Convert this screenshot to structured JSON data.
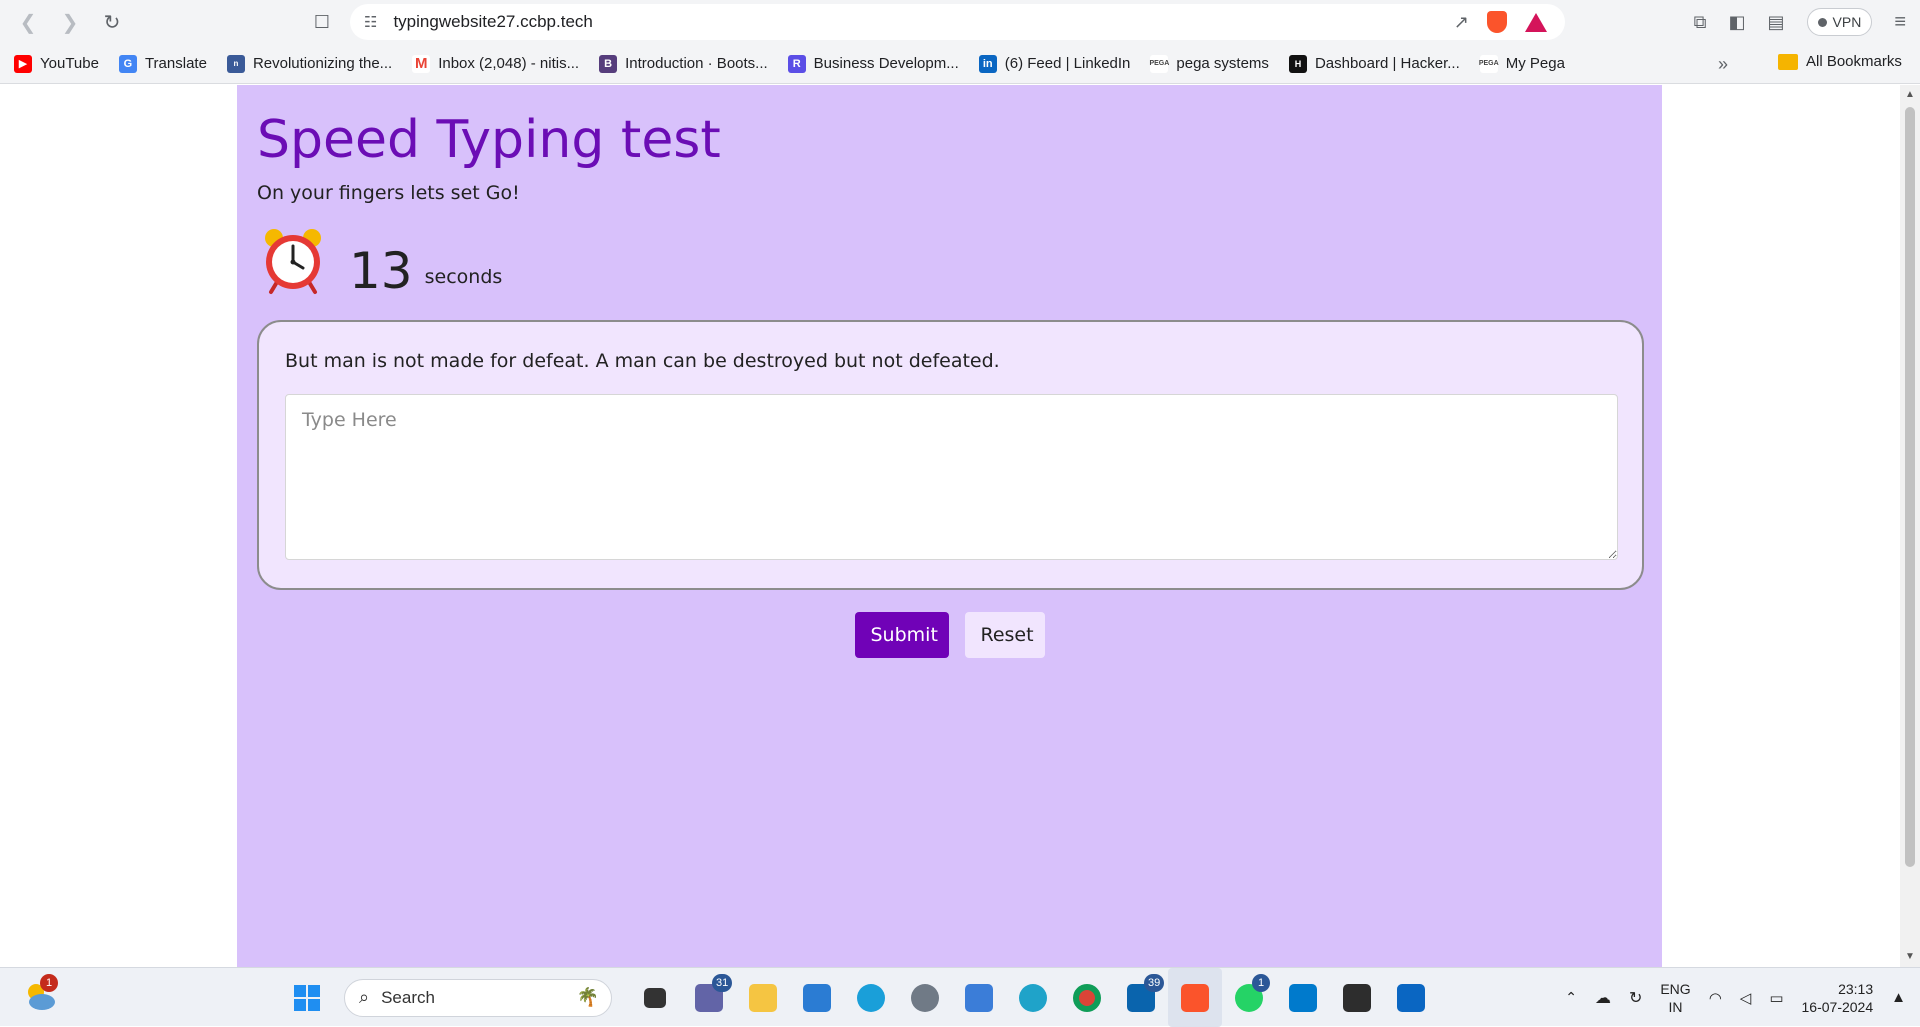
{
  "browser": {
    "url": "typingwebsite27.ccbp.tech",
    "vpn_label": "VPN",
    "bookmarks": [
      {
        "label": "YouTube",
        "icon": "youtube-icon",
        "color": "#ff0000"
      },
      {
        "label": "Translate",
        "icon": "translate-icon",
        "color": "#4285f4"
      },
      {
        "label": "Revolutionizing the...",
        "icon": "news-icon",
        "color": "#3a5a98"
      },
      {
        "label": "Inbox (2,048) - nitis...",
        "icon": "gmail-icon",
        "color": "#ea4335"
      },
      {
        "label": "Introduction · Boots...",
        "icon": "bootstrap-icon",
        "color": "#563d7c"
      },
      {
        "label": "Business Developm...",
        "icon": "r-icon",
        "color": "#5b4ee6"
      },
      {
        "label": "(6) Feed | LinkedIn",
        "icon": "linkedin-icon",
        "color": "#0a66c2"
      },
      {
        "label": "pega systems",
        "icon": "pega-icon",
        "color": "#444444"
      },
      {
        "label": "Dashboard | Hacker...",
        "icon": "hackerrank-icon",
        "color": "#111111"
      },
      {
        "label": "My Pega",
        "icon": "pega-icon",
        "color": "#444444"
      }
    ],
    "all_bookmarks": "All Bookmarks"
  },
  "page": {
    "title": "Speed Typing test",
    "subtitle": "On your fingers lets set Go!",
    "timer_value": "13",
    "timer_unit": "seconds",
    "quote": "But man is not made for defeat. A man can be destroyed but not defeated.",
    "input_placeholder": "Type Here",
    "submit_label": "Submit",
    "reset_label": "Reset"
  },
  "taskbar": {
    "weather_badge": "1",
    "search_label": "Search",
    "teams_badge": "31",
    "outlook_badge": "39",
    "whatsapp_badge": "1",
    "lang_top": "ENG",
    "lang_bottom": "IN",
    "time": "23:13",
    "date": "16-07-2024"
  },
  "colors": {
    "app_bg": "#d8c1fb",
    "title": "#6b0db5",
    "card_bg": "#f1e5fe",
    "submit_bg": "#7002b7"
  }
}
